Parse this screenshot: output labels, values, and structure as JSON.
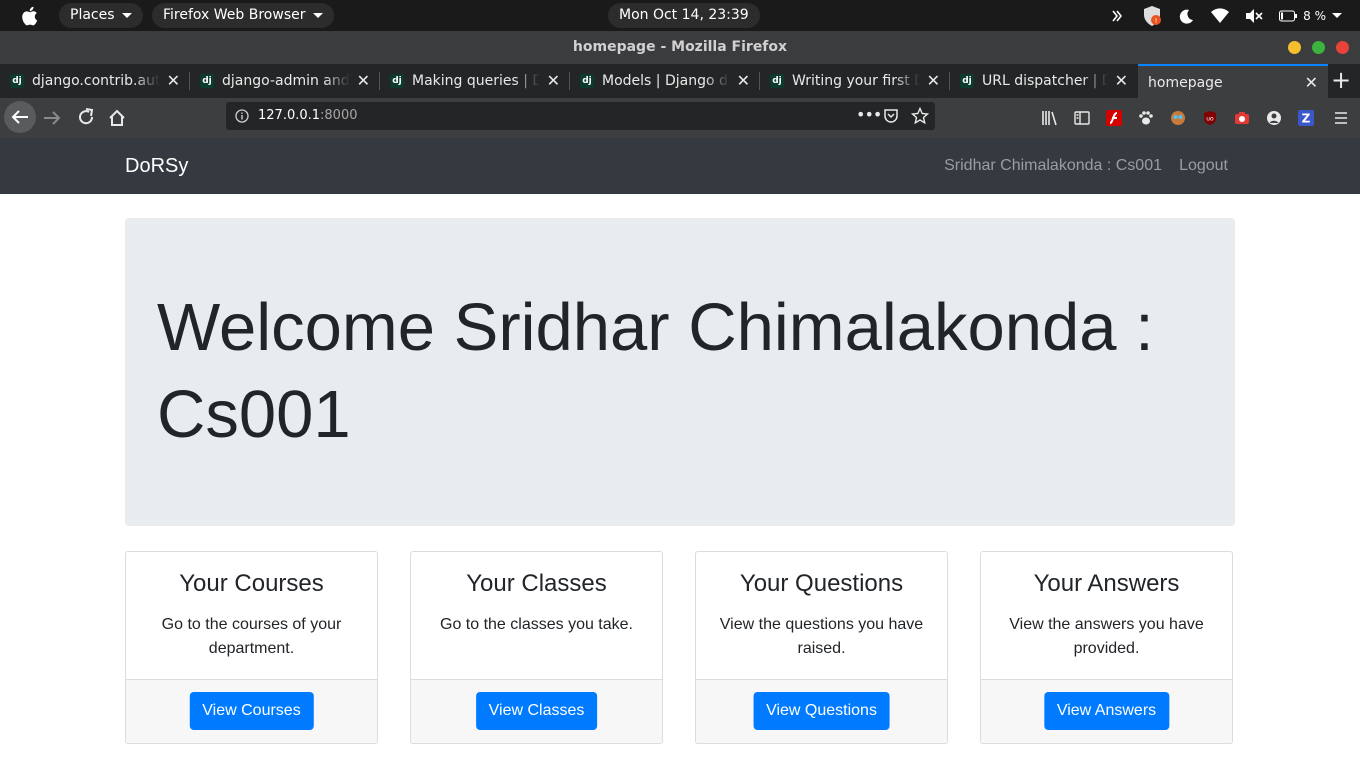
{
  "topbar": {
    "places": "Places",
    "app_menu": "Firefox Web Browser",
    "clock": "Mon Oct 14, 23:39",
    "battery": "8 %"
  },
  "window": {
    "title": "homepage - Mozilla Firefox"
  },
  "tabs": [
    {
      "label": "django.contrib.auth",
      "favicon": "dj"
    },
    {
      "label": "django-admin and manage.py",
      "favicon": "dj"
    },
    {
      "label": "Making queries | Django",
      "favicon": "dj"
    },
    {
      "label": "Models | Django documentation",
      "favicon": "dj"
    },
    {
      "label": "Writing your first Django app",
      "favicon": "dj"
    },
    {
      "label": "URL dispatcher | Django",
      "favicon": "dj"
    },
    {
      "label": "homepage"
    }
  ],
  "urlbar": {
    "host": "127.0.0.1",
    "port": ":8000"
  },
  "site": {
    "brand": "DoRSy",
    "user": "Sridhar Chimalakonda : Cs001",
    "logout": "Logout",
    "jumbotron_title": "Welcome Sridhar Chimalakonda : Cs001",
    "cards": [
      {
        "title": "Your Courses",
        "text": "Go to the courses of your department.",
        "button": "View Courses"
      },
      {
        "title": "Your Classes",
        "text": "Go to the classes you take.",
        "button": "View Classes"
      },
      {
        "title": "Your Questions",
        "text": "View the questions you have raised.",
        "button": "View Questions"
      },
      {
        "title": "Your Answers",
        "text": "View the answers you have provided.",
        "button": "View Answers"
      }
    ]
  },
  "colors": {
    "navbar_bg": "#343a40",
    "jumbotron_bg": "#e9ecef",
    "primary_button": "#007bff",
    "tab_accent": "#0a84ff"
  }
}
